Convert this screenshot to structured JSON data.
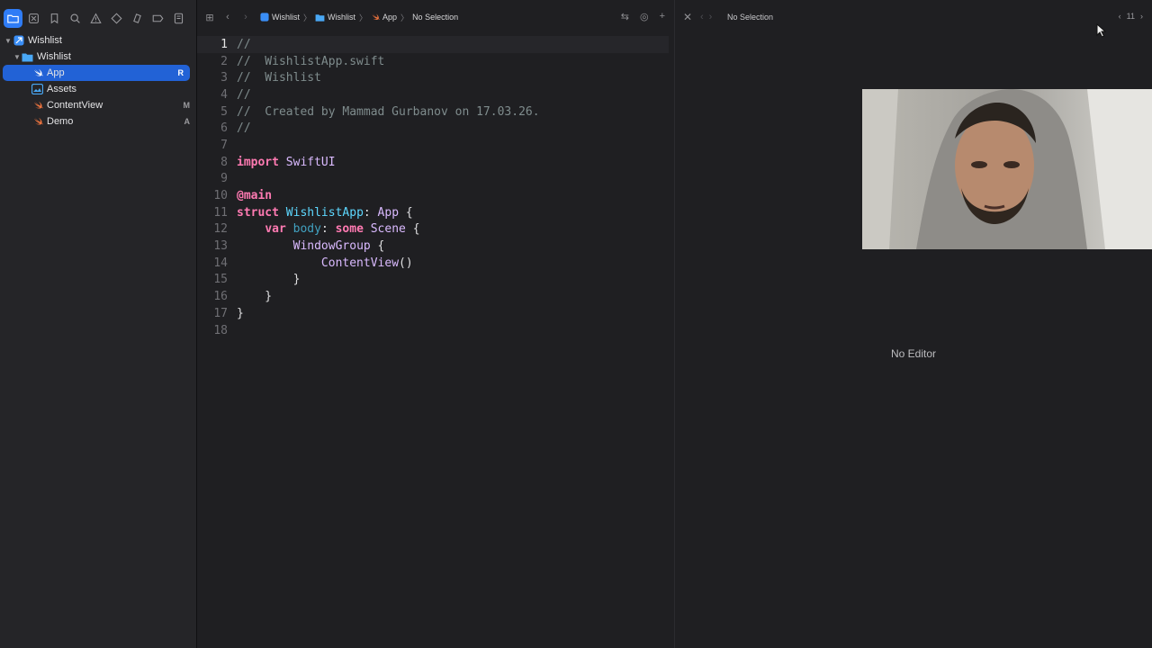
{
  "navigator": {
    "tabs": [
      {
        "icon": "folder-icon",
        "active": true
      },
      {
        "icon": "source-control-icon",
        "active": false
      },
      {
        "icon": "bookmark-icon",
        "active": false
      },
      {
        "icon": "search-icon",
        "active": false
      },
      {
        "icon": "warning-icon",
        "active": false
      },
      {
        "icon": "test-icon",
        "active": false
      },
      {
        "icon": "debug-icon",
        "active": false
      },
      {
        "icon": "breakpoint-icon",
        "active": false
      },
      {
        "icon": "report-icon",
        "active": false
      }
    ],
    "tree": [
      {
        "label": "Wishlist",
        "kind": "project",
        "indent": 0,
        "expanded": true,
        "badge": ""
      },
      {
        "label": "Wishlist",
        "kind": "folder",
        "indent": 1,
        "expanded": true,
        "badge": ""
      },
      {
        "label": "App",
        "kind": "swift",
        "indent": 2,
        "selected": true,
        "badge": "R"
      },
      {
        "label": "Assets",
        "kind": "assets",
        "indent": 2,
        "badge": ""
      },
      {
        "label": "ContentView",
        "kind": "swift",
        "indent": 2,
        "badge": "M"
      },
      {
        "label": "Demo",
        "kind": "swift",
        "indent": 2,
        "badge": "A"
      }
    ]
  },
  "editor_left": {
    "breadcrumb": [
      "Wishlist",
      "Wishlist",
      "App",
      "No Selection"
    ],
    "current_line": 1,
    "lines": [
      "//",
      "//  WishlistApp.swift",
      "//  Wishlist",
      "//",
      "//  Created by Mammad Gurbanov on 17.03.26.",
      "//",
      "",
      "import SwiftUI",
      "",
      "@main",
      "struct WishlistApp: App {",
      "    var body: some Scene {",
      "        WindowGroup {",
      "            ContentView()",
      "        }",
      "    }",
      "}",
      ""
    ]
  },
  "editor_right": {
    "breadcrumb": "No Selection",
    "counter": "11",
    "placeholder": "No Editor"
  },
  "colors": {
    "accent": "#2f7cf6",
    "selection": "#2262d6",
    "keyword": "#ff7ab2",
    "comment": "#7f8c8d"
  }
}
